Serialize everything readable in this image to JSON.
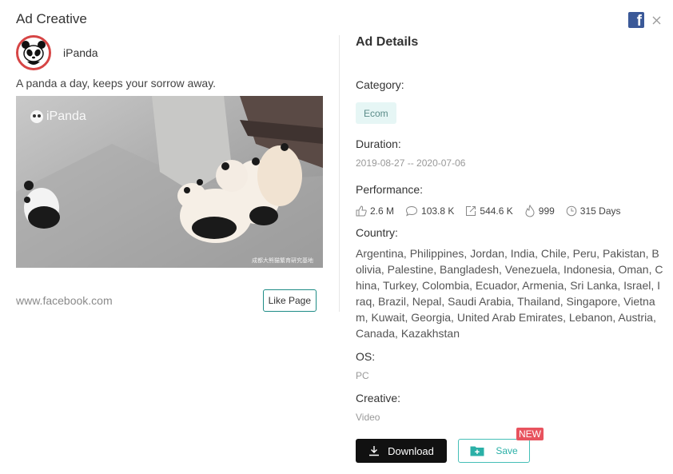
{
  "modal": {
    "title": "Ad Creative"
  },
  "icons": {
    "platform": "facebook-icon",
    "close": "close-icon"
  },
  "advertiser": {
    "name": "iPanda",
    "ad_text": "A panda a day, keeps your sorrow away.",
    "media_watermark": "iPanda",
    "media_caption": "成都大熊猫繁育研究基地",
    "site": "www.facebook.com",
    "like_page_label": "Like Page"
  },
  "details": {
    "title": "Ad Details",
    "category_label": "Category:",
    "category_value": "Ecom",
    "duration_label": "Duration:",
    "duration_value": "2019-08-27 -- 2020-07-06",
    "performance_label": "Performance:",
    "performance": {
      "likes": "2.6 M",
      "comments": "103.8 K",
      "shares": "544.6 K",
      "heat": "999",
      "days": "315 Days"
    },
    "country_label": "Country:",
    "countries": "Argentina, Philippines, Jordan, India, Chile, Peru, Pakistan, Bolivia, Palestine, Bangladesh, Venezuela, Indonesia, Oman, China, Turkey, Colombia, Ecuador, Armenia, Sri Lanka, Israel, Iraq, Brazil, Nepal, Saudi Arabia, Thailand, Singapore, Vietnam, Kuwait, Georgia, United Arab Emirates, Lebanon, Austria, Canada, Kazakhstan",
    "os_label": "OS:",
    "os_value": "PC",
    "creative_label": "Creative:",
    "creative_value": "Video"
  },
  "actions": {
    "download_label": "Download",
    "save_label": "Save",
    "new_badge": "NEW"
  },
  "colors": {
    "accent": "#2bb0a7",
    "facebook": "#3b5998",
    "badge": "#e8535e",
    "avatar_ring": "#d64545"
  }
}
